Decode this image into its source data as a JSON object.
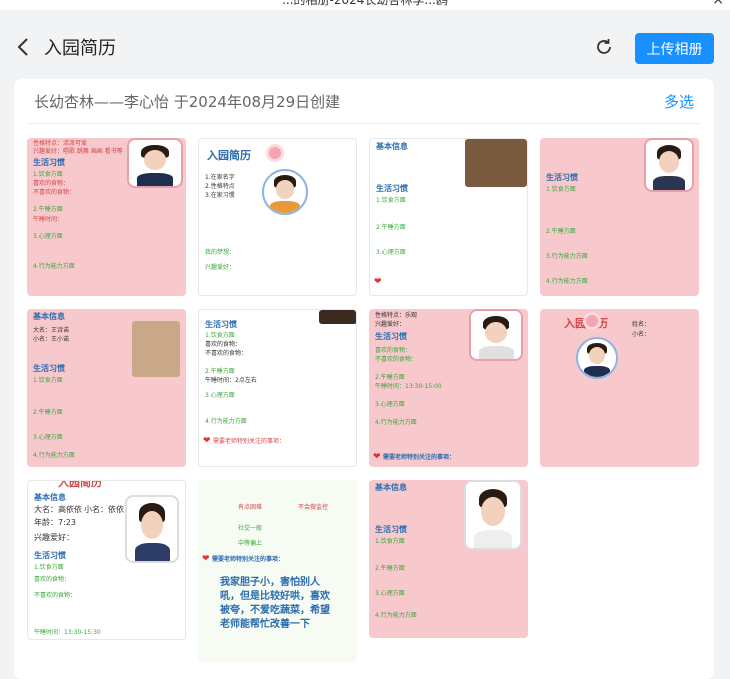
{
  "window": {
    "title": "...的相册-2024长幼杏林李...鸥",
    "close_glyph": "×"
  },
  "header": {
    "title": "入园简历",
    "upload_label": "上传相册"
  },
  "album": {
    "title": "长幼杏林——李心怡 于2024年08月29日创建",
    "multiselect_label": "多选"
  },
  "thumbnails": [
    {
      "lines": [
        "性格特点：活泼可爱",
        "兴趣爱好：唱歌 跳舞 画画 看书等",
        "生活习惯",
        "1.饮食方面",
        "喜欢的食物：",
        "不喜欢的食物：",
        "2.午睡方面",
        "午睡时间：",
        "3.心理方面",
        "4.行为能力方面"
      ]
    },
    {
      "lines": [
        "入园简历",
        "1.在家名字",
        "2.性格特点",
        "3.在家习惯",
        "我的梦想：",
        "兴趣爱好："
      ]
    },
    {
      "lines": [
        "基本信息",
        "生活习惯",
        "1.饮食方面",
        "2.午睡方面",
        "3.心理方面"
      ]
    },
    {
      "lines": [
        "生活习惯",
        "1.饮食方面",
        "2.午睡方面",
        "3.行为能力方面",
        "4.行为能力方面"
      ]
    },
    {
      "lines": [
        "基本信息",
        "大名：王诗诺",
        "小名：王小诺",
        "生活习惯",
        "1.饮食方面",
        "2.午睡方面",
        "3.心理方面",
        "4.行为能力方面"
      ]
    },
    {
      "lines": [
        "生活习惯",
        "1.饮食方面",
        "喜欢的食物：",
        "不喜欢的食物：",
        "2.午睡方面",
        "午睡时间：2点左右",
        "3.心理方面",
        "4.行为能力方面",
        "需要老师特别关注的事项："
      ]
    },
    {
      "lines": [
        "性格特点：乐观",
        "兴趣爱好：",
        "生活习惯",
        "喜欢的食物：",
        "不喜欢的食物：",
        "2.午睡方面",
        "午睡时间：13:30-15:00",
        "3.心理方面",
        "4.行为能力方面",
        "需要老师特别关注的事项："
      ]
    },
    {
      "lines": [
        "入园简历",
        "姓名：",
        "小名："
      ]
    },
    {
      "lines": [
        "入园简历",
        "基本信息",
        "大名：高依依",
        "小名：依依",
        "年龄：7:23",
        "兴趣爱好：",
        "生活习惯",
        "1.饮食方面",
        "喜欢的食物：",
        "不喜欢的食物：",
        "午睡时间：13:30-15:30"
      ]
    },
    {
      "lines": [
        "有点困难",
        "不会做监控",
        "社交一般",
        "中等偏上",
        "需要老师特别关注的事项：",
        "我家胆子小，害怕别人",
        "吼，但是比较好哄，喜欢",
        "被夸，不爱吃蔬菜，希望",
        "老师能帮忙改善一下"
      ]
    },
    {
      "lines": [
        "基本信息",
        "生活习惯",
        "1.饮食方面",
        "2.午睡方面",
        "3.心理方面",
        "4.行为能力方面"
      ]
    }
  ]
}
